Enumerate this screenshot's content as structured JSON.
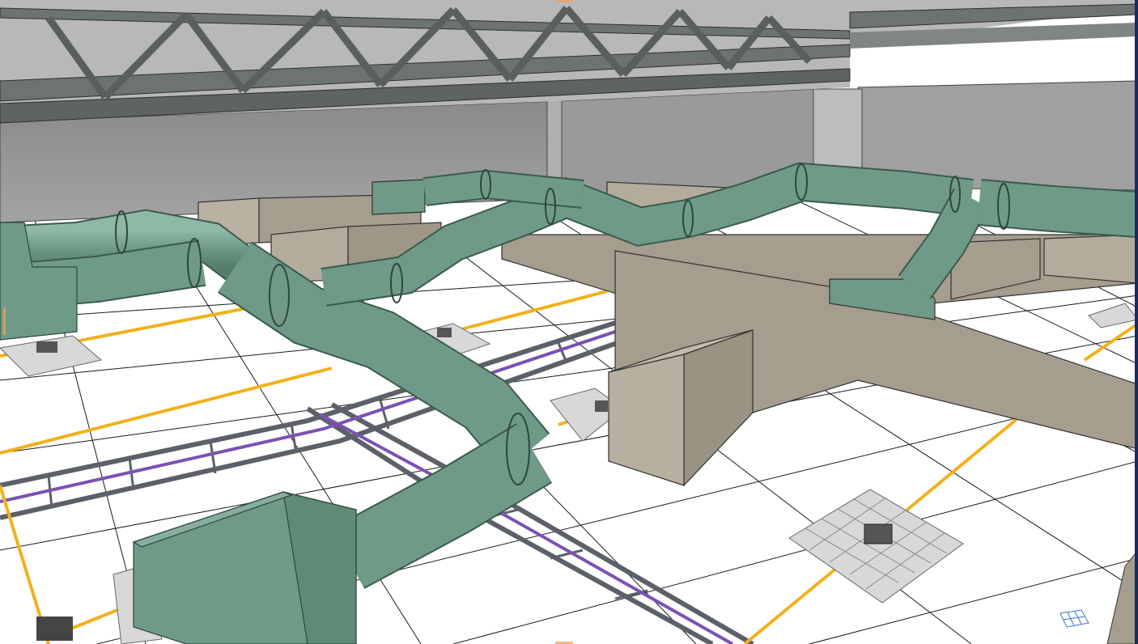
{
  "viewport": {
    "view": "3D perspective",
    "render_style": "shaded with edges",
    "selection_markers": [
      "top-center",
      "bottom-center",
      "left-middle"
    ]
  },
  "scene": {
    "elements": [
      {
        "name": "roof-truss",
        "material": "steel",
        "color": "#6d7373"
      },
      {
        "name": "back-wall",
        "color": "#8e8e8e"
      },
      {
        "name": "side-wall",
        "color": "#9b9b9b"
      },
      {
        "name": "floor-grid",
        "color": "#ffffff"
      },
      {
        "name": "hvac-pipe",
        "count": 4,
        "color": "#6f9a88"
      },
      {
        "name": "rectangular-duct",
        "count": 3,
        "color": "#a59d8d"
      },
      {
        "name": "cable-tray",
        "count": 2,
        "color": "#5c6068"
      },
      {
        "name": "purple-conduit",
        "count": 2,
        "color": "#7b52b3"
      },
      {
        "name": "yellow-conduit",
        "count": 6,
        "color": "#f2b11c"
      },
      {
        "name": "floor-box-array",
        "count": 6,
        "color": "#d8d8d8"
      },
      {
        "name": "view-cube-icon",
        "color": "#3d6fd0"
      }
    ]
  }
}
